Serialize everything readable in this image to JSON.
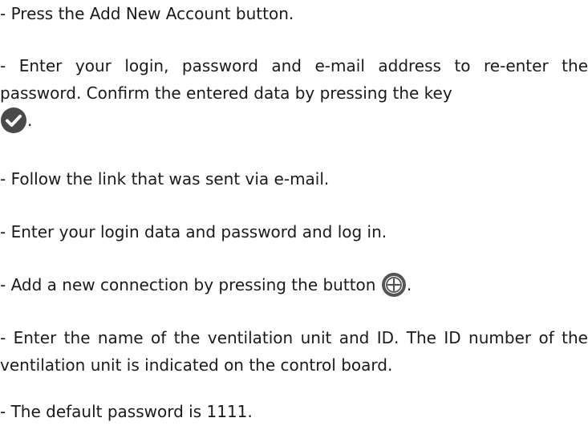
{
  "steps": [
    {
      "text": "- Press the Add New Account button."
    },
    {
      "text": "- Enter your login, password and e-mail address to re-enter the password. Confirm the entered data by pressing the key",
      "suffix": ".",
      "icon": "check-circle-icon"
    },
    {
      "text": "- Follow the link that was sent via e-mail."
    },
    {
      "text": "- Enter your login data and password and log in."
    },
    {
      "text": "- Add a new connection by pressing the button",
      "suffix": ".",
      "icon": "plus-circle-icon"
    },
    {
      "text": "- Enter the name of the ventilation unit and ID. The ID number of the ventilation unit is indicated on the control board."
    },
    {
      "text": "- The default password is 1111."
    }
  ],
  "colors": {
    "text": "#1a1a1a",
    "check_icon": "#4a4a4a",
    "plus_icon": "#555555"
  }
}
